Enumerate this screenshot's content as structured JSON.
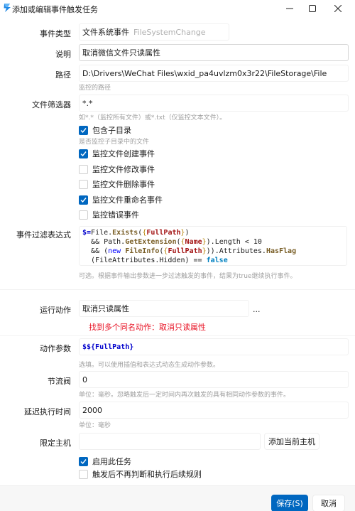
{
  "window": {
    "title": "添加或编辑事件触发任务"
  },
  "form": {
    "event_type": {
      "label": "事件类型",
      "value": "文件系统事件",
      "secondary": "FileSystemChange"
    },
    "description": {
      "label": "说明",
      "value": "取消微信文件只读属性"
    },
    "path": {
      "label": "路径",
      "value": "D:\\Drivers\\WeChat Files\\wxid_pa4uvlzm0x3r22\\FileStorage\\File",
      "hint": "监控的路径"
    },
    "filter": {
      "label": "文件筛选器",
      "value": "*.*",
      "hint": "如*.*（监控所有文件）或*.txt（仅监控文本文件）。"
    },
    "checkboxes": [
      {
        "label": "包含子目录",
        "checked": true,
        "hint": "是否监控子目录中的文件"
      },
      {
        "label": "监控文件创建事件",
        "checked": true
      },
      {
        "label": "监控文件修改事件",
        "checked": false
      },
      {
        "label": "监控文件删除事件",
        "checked": false
      },
      {
        "label": "监控文件重命名事件",
        "checked": true
      },
      {
        "label": "监控错误事件",
        "checked": false
      }
    ],
    "expression": {
      "label": "事件过滤表达式",
      "lines": [
        "$=File.Exists({FullPath})",
        "  && Path.GetExtension({Name}).Length < 10",
        "  && (new FileInfo({FullPath})).Attributes.HasFlag",
        "  (FileAttributes.Hidden) == false"
      ],
      "hint": "可选。根据事件输出参数进一步过滤触发的事件，结果为true继续执行事件。"
    },
    "action": {
      "label": "运行动作",
      "value": "取消只读属性",
      "more": "...",
      "error": "找到多个同名动作：取消只读属性"
    },
    "action_params": {
      "label": "动作参数",
      "value": "$${FullPath}",
      "hint": "选填。可以使用插值和表达式动态生成动作参数。"
    },
    "throttle": {
      "label": "节流阀",
      "value": "0",
      "hint": "单位：毫秒。忽略触发后一定时间内再次触发的具有相同动作参数的事件。"
    },
    "delay": {
      "label": "延迟执行时间",
      "value": "2000",
      "hint": "单位：毫秒"
    },
    "host": {
      "label": "限定主机",
      "value": "",
      "add_button": "添加当前主机"
    },
    "bottom_checks": [
      {
        "label": "启用此任务",
        "checked": true
      },
      {
        "label": "触发后不再判断和执行后续规则",
        "checked": false
      }
    ]
  },
  "footer": {
    "save": "保存(S)",
    "cancel": "取消"
  },
  "colors": {
    "accent": "#0067c0",
    "error": "#e81123",
    "hint": "#a0a0a0"
  }
}
